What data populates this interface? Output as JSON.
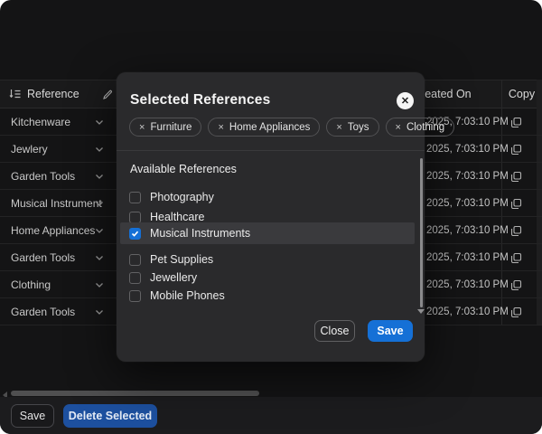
{
  "table": {
    "reference_header": "Reference",
    "created_on_header": "Created On",
    "copy_header": "Copy",
    "rows": [
      {
        "reference": "Kitchenware",
        "created_on": "2025, 7:03:10 PM"
      },
      {
        "reference": "Jewlery",
        "created_on": "2025, 7:03:10 PM"
      },
      {
        "reference": "Garden Tools",
        "created_on": "2025, 7:03:10 PM"
      },
      {
        "reference": "Musical Instrument",
        "created_on": "2025, 7:03:10 PM"
      },
      {
        "reference": "Home Appliances",
        "created_on": "2025, 7:03:10 PM"
      },
      {
        "reference": "Garden Tools",
        "created_on": "2025, 7:03:10 PM"
      },
      {
        "reference": "Clothing",
        "created_on": "2025, 7:03:10 PM"
      },
      {
        "reference": "Garden Tools",
        "created_on": "2025, 7:03:10 PM"
      }
    ]
  },
  "modal": {
    "title": "Selected References",
    "close_icon": "✕",
    "tag_remove_icon": "×",
    "selected_tags": [
      {
        "label": "Furniture"
      },
      {
        "label": "Home Appliances"
      },
      {
        "label": "Toys"
      },
      {
        "label": "Clothing"
      }
    ],
    "available_references_label": "Available References",
    "options": [
      {
        "label": "Photography",
        "checked": false
      },
      {
        "label": "Healthcare",
        "checked": false
      },
      {
        "label": "Musical Instruments",
        "checked": true
      },
      {
        "label": "Pet Supplies",
        "checked": false
      },
      {
        "label": "Jewellery",
        "checked": false
      },
      {
        "label": "Mobile Phones",
        "checked": false
      }
    ],
    "buttons": {
      "close": "Close",
      "save": "Save"
    }
  },
  "footer": {
    "save": "Save",
    "delete_selected": "Delete Selected"
  },
  "colors": {
    "accent_blue": "#1570d6",
    "delete_button_blue": "#1d509f",
    "modal_background": "#2a2a2c",
    "page_background": "#141415",
    "row_highlight": "#3a3a3d"
  }
}
